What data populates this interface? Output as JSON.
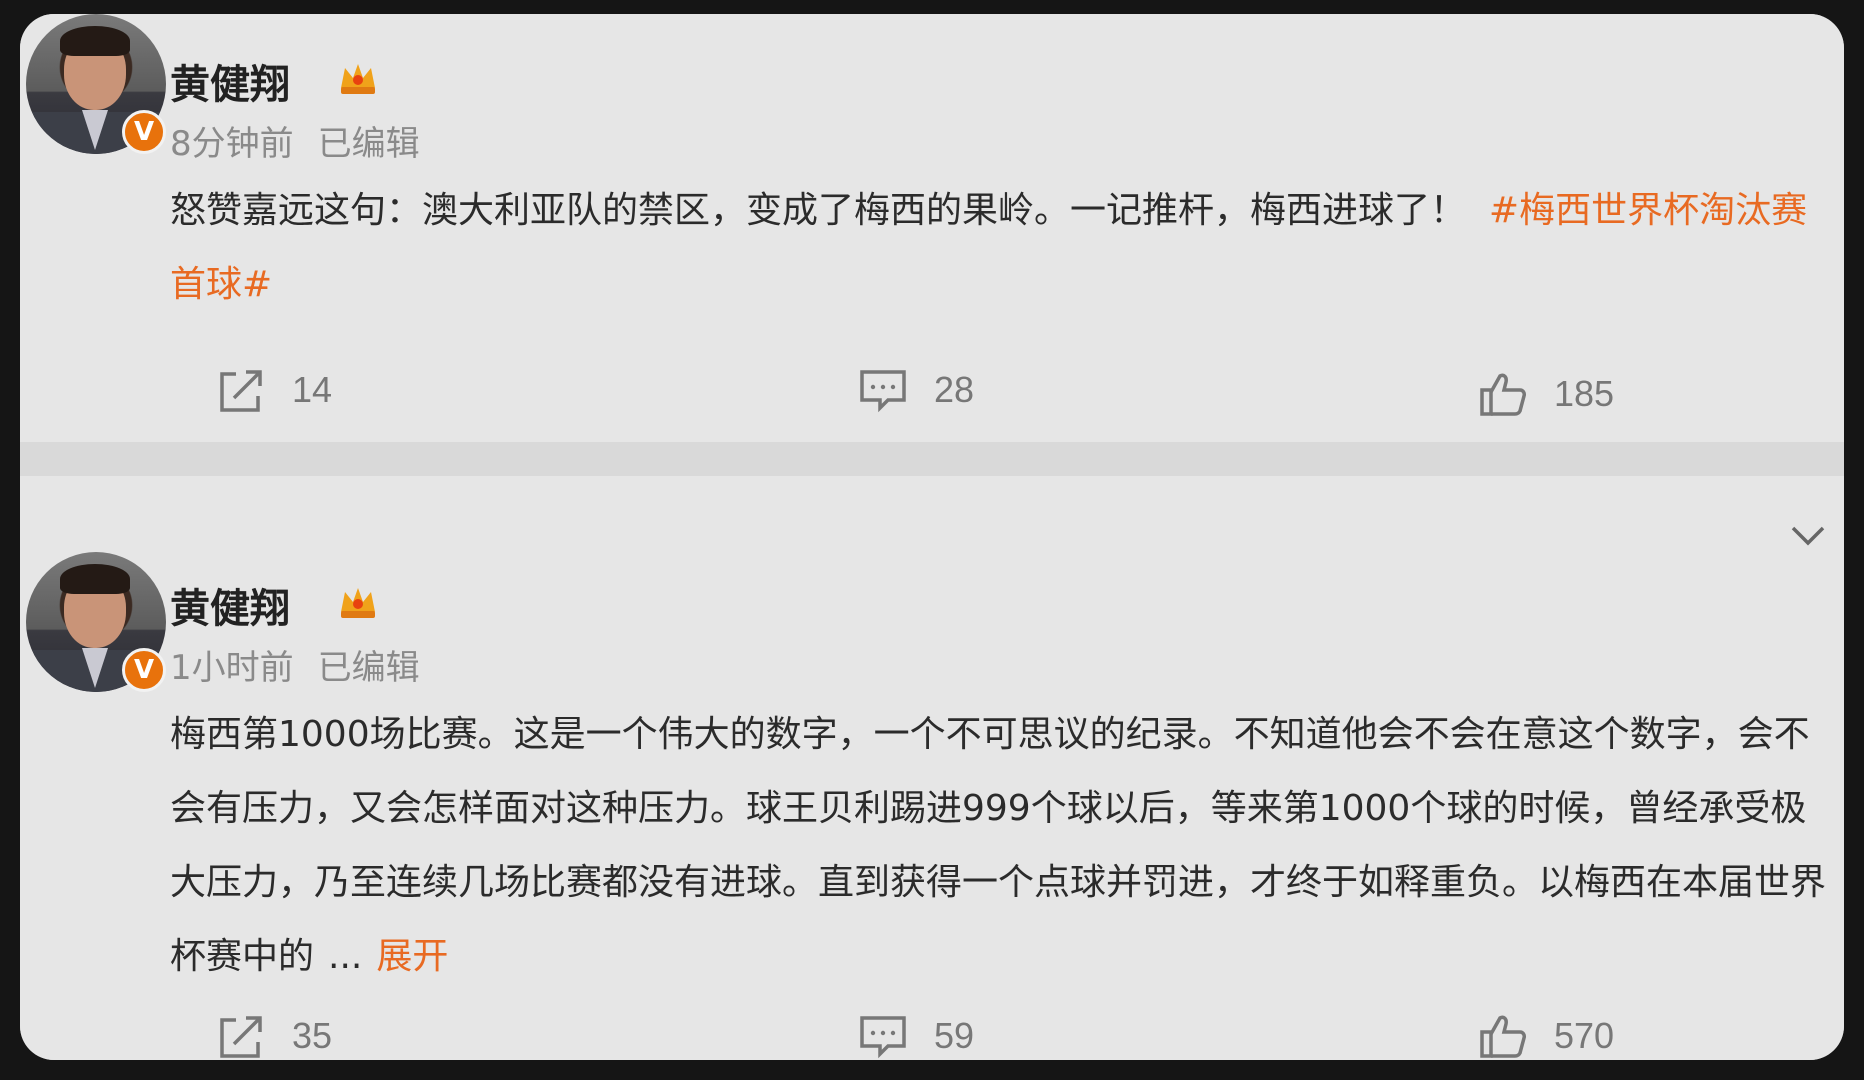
{
  "posts": [
    {
      "author": "黄健翔",
      "time": "8分钟前",
      "edited": "已编辑",
      "content_text": "怒赞嘉远这句：澳大利亚队的禁区，变成了梅西的果岭。一记推杆，梅西进球了！",
      "hashtag": "#梅西世界杯淘汰赛首球#",
      "repost_count": "14",
      "comment_count": "28",
      "like_count": "185",
      "verified_badge": "V"
    },
    {
      "author": "黄健翔",
      "time": "1小时前",
      "edited": "已编辑",
      "content_text": "梅西第1000场比赛。这是一个伟大的数字，一个不可思议的纪录。不知道他会不会在意这个数字，会不会有压力，又会怎样面对这种压力。球王贝利踢进999个球以后，等来第1000个球的时候，曾经承受极大压力，乃至连续几场比赛都没有进球。直到获得一个点球并罚进，才终于如释重负。以梅西在本届世界杯赛中的",
      "ellipsis": "...",
      "expand_label": "展开",
      "repost_count": "35",
      "comment_count": "59",
      "like_count": "570",
      "verified_badge": "V"
    }
  ],
  "icons": {
    "repost": "repost-icon",
    "comment": "comment-icon",
    "like": "like-icon",
    "crown": "crown-icon",
    "chevron": "chevron-down-icon"
  },
  "colors": {
    "accent": "#e86a22",
    "badge": "#e8720c",
    "text": "#2b2b2b",
    "meta": "#8a8a8a"
  }
}
